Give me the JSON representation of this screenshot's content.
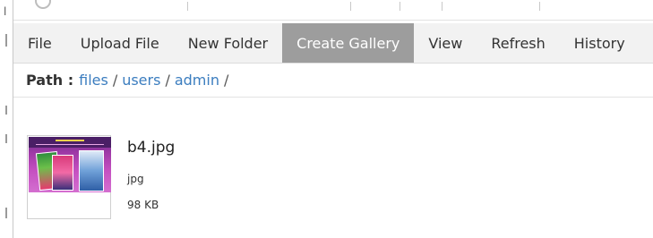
{
  "menu": {
    "items": [
      {
        "label": "File",
        "active": false
      },
      {
        "label": "Upload File",
        "active": false
      },
      {
        "label": "New Folder",
        "active": false
      },
      {
        "label": "Create Gallery",
        "active": true
      },
      {
        "label": "View",
        "active": false
      },
      {
        "label": "Refresh",
        "active": false
      },
      {
        "label": "History",
        "active": false
      }
    ]
  },
  "path": {
    "label": "Path :",
    "crumbs": [
      "files",
      "users",
      "admin"
    ],
    "separator": "/"
  },
  "file": {
    "name": "b4.jpg",
    "type": "jpg",
    "size": "98 KB",
    "thumbnail_icon": "image-thumbnail-icon"
  },
  "colors": {
    "menu_bg": "#f2f2f2",
    "menu_active_bg": "#9d9d9d",
    "link": "#3b7dbf"
  }
}
